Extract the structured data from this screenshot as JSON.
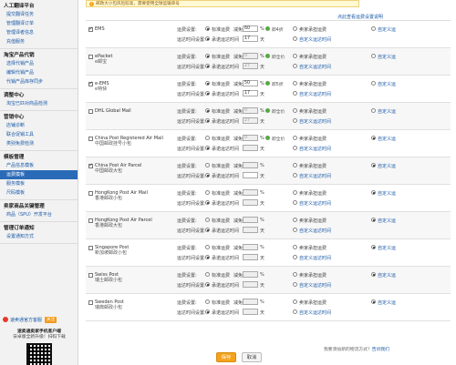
{
  "sidebar": {
    "groups": [
      {
        "title": "人工翻译平台",
        "items": [
          "提交翻译任务",
          "管理翻译订单",
          "管理译者信息",
          "充值服务"
        ]
      },
      {
        "title": "淘宝产品代销",
        "items": [
          "选择代销产品",
          "编辑代销产品",
          "代销产品库存同步"
        ]
      },
      {
        "title": "调整中心",
        "items": [
          "淘宝已匹对商品检测"
        ]
      },
      {
        "title": "营销中心",
        "items": [
          "店铺诊断",
          "联合促销工具",
          "类别免费检测"
        ]
      },
      {
        "title": "模板管理",
        "items": [
          "产品信息模板",
          "运费模板",
          "服务模板",
          "尺码模板"
        ]
      },
      {
        "title": "卖家商品关键管理",
        "items": [
          "商品（SPU）开发平台"
        ]
      },
      {
        "title": "管理订单通知",
        "items": [
          "设置通知方式"
        ]
      }
    ],
    "active_item": "运费模板",
    "promo": {
      "text": "速卖通官方客服",
      "button": "关注"
    },
    "download": {
      "title": "速卖通卖家手机客户端",
      "text": "安卓版全新升级！扫码下载"
    }
  },
  "notice": "邮政大小包风险较高，需要使用全球运输单号",
  "top_link": "点此查看运费设置说明",
  "labels": {
    "shipping_setting": "运费设置:",
    "delivery_time": "运达时间设置:",
    "standard": "标准运费",
    "discount": "减免",
    "percent": "%",
    "free_shipping": "卖家承担运费",
    "promised_time": "承诺运达时间",
    "day": "天",
    "custom_shipping": "自定义运费",
    "custom_time": "自定义运达时间",
    "custom_short": "自定义运"
  },
  "services": [
    {
      "name": "EMS",
      "cn": "",
      "checked": true,
      "discount": "60",
      "days": "17",
      "note": "即4折",
      "days_disabled": false,
      "disabled": false,
      "mode": "standard"
    },
    {
      "name": "ePacket",
      "cn": "e邮宝",
      "checked": false,
      "discount": "0",
      "days": "27",
      "note": "即全价",
      "days_disabled": true,
      "disabled": true,
      "mode": "standard"
    },
    {
      "name": "e-EMS",
      "cn": "e特快",
      "checked": true,
      "discount": "50",
      "days": "17",
      "note": "即5折",
      "days_disabled": false,
      "disabled": false,
      "mode": "standard"
    },
    {
      "name": "DHL Global Mail",
      "cn": "",
      "checked": false,
      "discount": "0",
      "days": "27",
      "note": "即全价",
      "days_disabled": true,
      "disabled": true,
      "mode": "standard"
    },
    {
      "name": "China Post Registered Air Mail",
      "cn": "中国邮政挂号小包",
      "checked": false,
      "discount": "0",
      "days": "",
      "note": "即全价",
      "days_disabled": true,
      "disabled": true,
      "mode": "custom"
    },
    {
      "name": "China Post Air Parcel",
      "cn": "中国邮政大包",
      "checked": true,
      "discount": "",
      "days": "",
      "note": "",
      "days_disabled": false,
      "disabled": false,
      "mode": "custom"
    },
    {
      "name": "HongKong Post Air Mail",
      "cn": "香港邮政小包",
      "checked": false,
      "discount": "",
      "days": "",
      "note": "",
      "days_disabled": true,
      "disabled": true,
      "mode": "custom"
    },
    {
      "name": "HongKong Post Air Parcel",
      "cn": "香港邮政大包",
      "checked": false,
      "discount": "",
      "days": "",
      "note": "",
      "days_disabled": true,
      "disabled": true,
      "mode": "custom"
    },
    {
      "name": "Singapore Post",
      "cn": "新加坡邮政小包",
      "checked": false,
      "discount": "",
      "days": "",
      "note": "",
      "days_disabled": true,
      "disabled": true,
      "mode": "custom"
    },
    {
      "name": "Swiss Post",
      "cn": "瑞士邮政小包",
      "checked": false,
      "discount": "",
      "days": "",
      "note": "",
      "days_disabled": true,
      "disabled": true,
      "mode": "custom"
    },
    {
      "name": "Sweden Post",
      "cn": "瑞典邮政小包",
      "checked": false,
      "discount": "",
      "days": "",
      "note": "",
      "days_disabled": true,
      "disabled": true,
      "mode": "custom"
    }
  ],
  "footer": {
    "text": "我要添加新的物流方式？",
    "link": "告诉我们"
  },
  "buttons": {
    "save": "保存",
    "cancel": "取消"
  },
  "colors": {
    "accent": "#f4a31d",
    "link": "#1a5aa8",
    "active_nav": "#2a6bb8"
  }
}
